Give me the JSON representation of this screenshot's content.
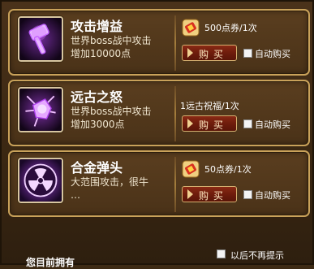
{
  "items": [
    {
      "name": "攻击增益",
      "desc": "世界boss战中攻击\n增加10000点",
      "price": "500点券/1次",
      "price_currency_icon": "coupon-icon",
      "buy_label": "购买",
      "auto_buy_label": "自动购买",
      "icon": "hammer-icon"
    },
    {
      "name": "远古之怒",
      "desc": "世界boss战中攻击\n增加3000点",
      "price": "1远古祝福/1次",
      "price_currency_icon": "",
      "buy_label": "购买",
      "auto_buy_label": "自动购买",
      "icon": "fist-icon"
    },
    {
      "name": "合金弹头",
      "desc": "大范围攻击，很牛\n…",
      "price": "50点券/1次",
      "price_currency_icon": "coupon-icon",
      "buy_label": "购买",
      "auto_buy_label": "自动购买",
      "icon": "radiation-icon"
    }
  ],
  "footer": {
    "dont_show_label": "以后不再提示",
    "owned_label": "您目前拥有"
  },
  "colors": {
    "frame_gold": "#c9a25a",
    "buy_button": "#7a2010",
    "icon_purple": "#b040f0"
  }
}
